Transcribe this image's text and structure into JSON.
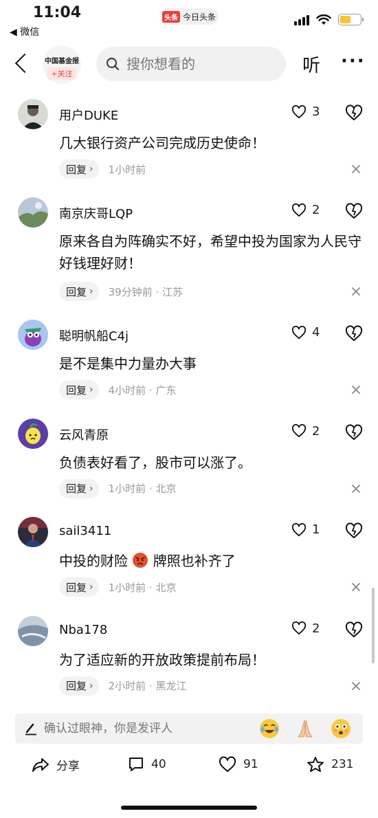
{
  "status_bar": {
    "time": "11:04",
    "back_app": "◀ 微信",
    "app_name": "今日头条",
    "app_badge": "头条"
  },
  "nav": {
    "publisher": "中国基金报",
    "follow": "+关注",
    "search_placeholder": "搜你想看的",
    "listen": "听",
    "more": "···"
  },
  "comments": [
    {
      "user": "用户DUKE",
      "likes": "3",
      "text": "几大银行资产公司完成历史使命！",
      "reply": "回复",
      "meta": "1小时前"
    },
    {
      "user": "南京庆哥LQP",
      "likes": "2",
      "text": "原来各自为阵确实不好，希望中投为国家为人民守好钱理好财！",
      "reply": "回复",
      "meta": "39分钟前 · 江苏"
    },
    {
      "user": "聪明帆船C4j",
      "likes": "4",
      "text": "是不是集中力量办大事",
      "reply": "回复",
      "meta": "4小时前 · 广东"
    },
    {
      "user": "云风青原",
      "likes": "2",
      "text": "负债表好看了，股市可以涨了。",
      "reply": "回复",
      "meta": "1小时前 · 北京"
    },
    {
      "user": "sail3411",
      "likes": "1",
      "text_before": "中投的财险",
      "text_after": "牌照也补齐了",
      "reply": "回复",
      "meta": "1小时前 · 北京"
    },
    {
      "user": "Nba178",
      "likes": "2",
      "text": "为了适应新的开放政策提前布局！",
      "reply": "回复",
      "meta": "2小时前 · 黑龙江"
    }
  ],
  "input_bar": {
    "placeholder": "确认过眼神，你是发评人"
  },
  "actions": {
    "share": "分享",
    "comments": "40",
    "likes": "91",
    "favorites": "231"
  },
  "colors": {
    "accent_red": "#e8423b",
    "battery": "#f6c534"
  }
}
